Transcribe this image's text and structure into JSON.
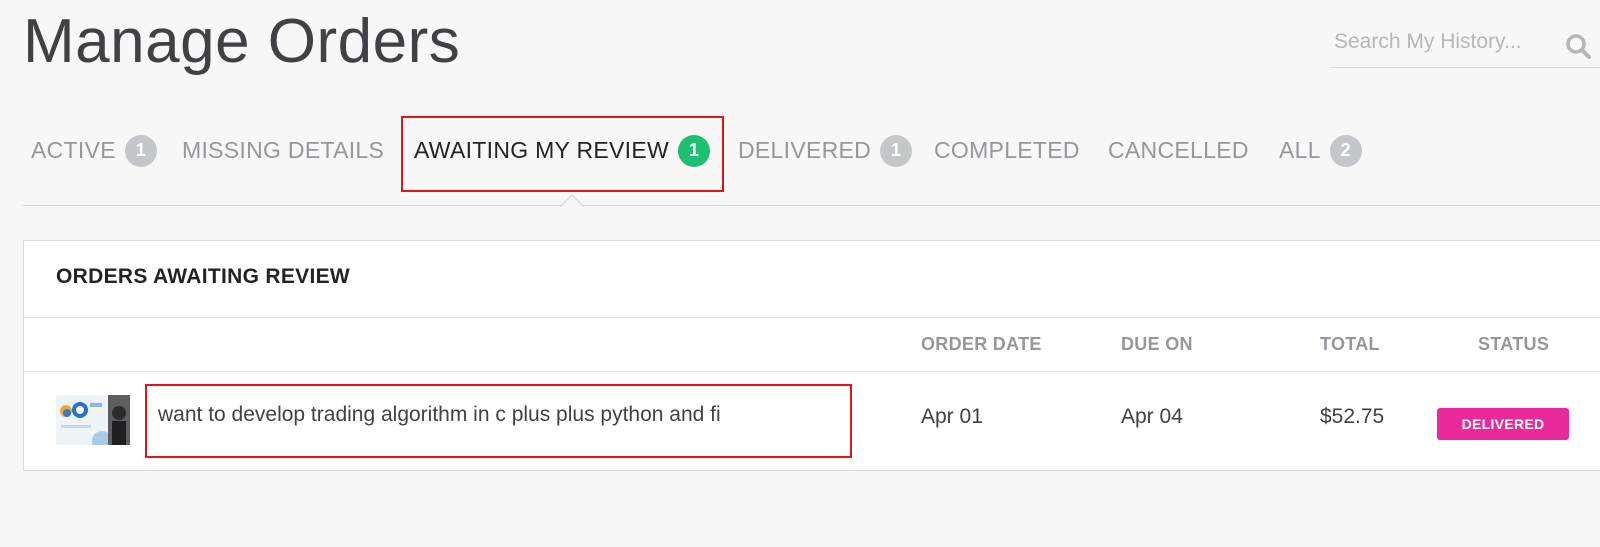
{
  "header": {
    "title": "Manage Orders",
    "search_placeholder": "Search My History..."
  },
  "tabs": [
    {
      "label": "ACTIVE",
      "count": "1",
      "active": false
    },
    {
      "label": "MISSING DETAILS",
      "count": null,
      "active": false
    },
    {
      "label": "AWAITING MY REVIEW",
      "count": "1",
      "active": true
    },
    {
      "label": "DELIVERED",
      "count": "1",
      "active": false
    },
    {
      "label": "COMPLETED",
      "count": null,
      "active": false
    },
    {
      "label": "CANCELLED",
      "count": null,
      "active": false
    },
    {
      "label": "ALL",
      "count": "2",
      "active": false
    }
  ],
  "orders_section": {
    "title": "ORDERS AWAITING REVIEW",
    "columns": {
      "order_date": "ORDER DATE",
      "due_on": "DUE ON",
      "total": "TOTAL",
      "status": "STATUS"
    },
    "rows": [
      {
        "gig_title": "want to develop trading algorithm in c plus plus python and fi",
        "order_date": "Apr 01",
        "due_on": "Apr 04",
        "total": "$52.75",
        "status": "DELIVERED"
      }
    ]
  },
  "colors": {
    "accent_green": "#1dbf73",
    "status_delivered": "#ea2a9c",
    "highlight_red": "#e0161b"
  },
  "icons": {
    "search": "search-icon",
    "tab_caret": "caret-up-icon",
    "order_thumbnail": "gig-thumbnail"
  }
}
